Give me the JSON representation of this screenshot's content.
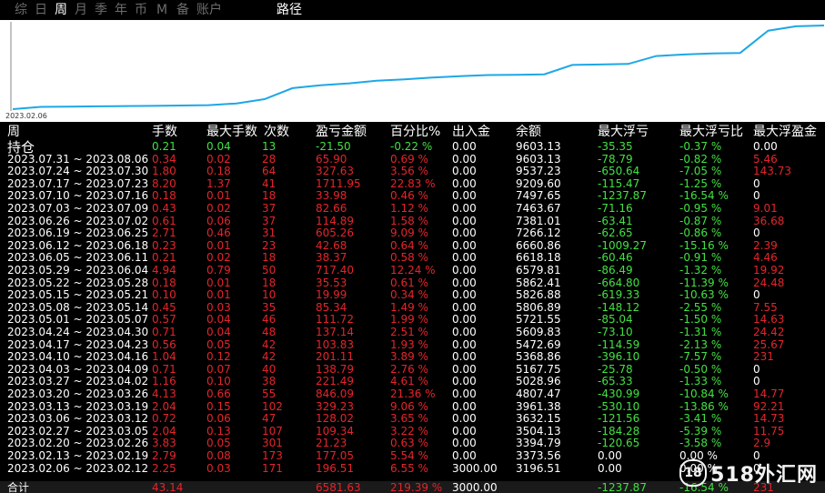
{
  "tabs": [
    {
      "label": "综",
      "active": false
    },
    {
      "label": "日",
      "active": false
    },
    {
      "label": "周",
      "active": true
    },
    {
      "label": "月",
      "active": false
    },
    {
      "label": "季",
      "active": false
    },
    {
      "label": "年",
      "active": false
    },
    {
      "label": "币",
      "active": false
    },
    {
      "label": "M",
      "active": false
    },
    {
      "label": "备",
      "active": false
    },
    {
      "label": "账户",
      "active": false
    }
  ],
  "path_label": "路径",
  "chart_data": {
    "type": "line",
    "x_start_label": "2023.02.06",
    "series": [
      {
        "values": [
          3196.51,
          3373.56,
          3394.79,
          3415.0,
          3432.0,
          3445.0,
          3474.0,
          3504.13,
          3632.15,
          3961.38,
          4807.47,
          5028.96,
          5167.75,
          5368.86,
          5472.69,
          5609.83,
          5721.55,
          5806.89,
          5826.88,
          5862.41,
          6579.81,
          6618.18,
          6660.86,
          7266.12,
          7381.01,
          7463.67,
          7497.65,
          9209.6,
          9537.23,
          9603.13
        ]
      }
    ],
    "color": "#1ea7e6"
  },
  "table": {
    "headers": [
      "周",
      "手数",
      "最大手数",
      "次数",
      "盈亏金额",
      "百分比%",
      "出入金",
      "余额",
      "最大浮亏",
      "最大浮亏比",
      "最大浮盈金"
    ],
    "rows": [
      {
        "label": "持仓",
        "cells": [
          "0.21",
          "0.04",
          "13",
          "-21.50",
          "-0.22 %",
          "0.00",
          "9603.13",
          "-35.35",
          "-0.37 %",
          "0.00"
        ],
        "tone": "green"
      },
      {
        "label": "2023.07.31 ~ 2023.08.06",
        "cells": [
          "0.34",
          "0.02",
          "28",
          "65.90",
          "0.69 %",
          "0.00",
          "9603.13",
          "-78.79",
          "-0.82 %",
          "5.46"
        ],
        "tone": "red"
      },
      {
        "label": "2023.07.24 ~ 2023.07.30",
        "cells": [
          "1.80",
          "0.18",
          "64",
          "327.63",
          "3.56 %",
          "0.00",
          "9537.23",
          "-650.64",
          "-7.05 %",
          "143.73"
        ],
        "tone": "red"
      },
      {
        "label": "2023.07.17 ~ 2023.07.23",
        "cells": [
          "8.20",
          "1.37",
          "41",
          "1711.95",
          "22.83 %",
          "0.00",
          "9209.60",
          "-115.47",
          "-1.25 %",
          "0"
        ],
        "tone": "red"
      },
      {
        "label": "2023.07.10 ~ 2023.07.16",
        "cells": [
          "0.18",
          "0.01",
          "18",
          "33.98",
          "0.46 %",
          "0.00",
          "7497.65",
          "-1237.87",
          "-16.54 %",
          "0"
        ],
        "tone": "red"
      },
      {
        "label": "2023.07.03 ~ 2023.07.09",
        "cells": [
          "0.43",
          "0.02",
          "37",
          "82.66",
          "1.12 %",
          "0.00",
          "7463.67",
          "-71.16",
          "-0.95 %",
          "9.01"
        ],
        "tone": "red"
      },
      {
        "label": "2023.06.26 ~ 2023.07.02",
        "cells": [
          "0.61",
          "0.06",
          "37",
          "114.89",
          "1.58 %",
          "0.00",
          "7381.01",
          "-63.41",
          "-0.87 %",
          "36.68"
        ],
        "tone": "red"
      },
      {
        "label": "2023.06.19 ~ 2023.06.25",
        "cells": [
          "2.71",
          "0.46",
          "31",
          "605.26",
          "9.09 %",
          "0.00",
          "7266.12",
          "-62.65",
          "-0.86 %",
          "0"
        ],
        "tone": "red"
      },
      {
        "label": "2023.06.12 ~ 2023.06.18",
        "cells": [
          "0.23",
          "0.01",
          "23",
          "42.68",
          "0.64 %",
          "0.00",
          "6660.86",
          "-1009.27",
          "-15.16 %",
          "2.39"
        ],
        "tone": "red"
      },
      {
        "label": "2023.06.05 ~ 2023.06.11",
        "cells": [
          "0.21",
          "0.02",
          "18",
          "38.37",
          "0.58 %",
          "0.00",
          "6618.18",
          "-60.46",
          "-0.91 %",
          "4.46"
        ],
        "tone": "red"
      },
      {
        "label": "2023.05.29 ~ 2023.06.04",
        "cells": [
          "4.94",
          "0.79",
          "50",
          "717.40",
          "12.24 %",
          "0.00",
          "6579.81",
          "-86.49",
          "-1.32 %",
          "19.92"
        ],
        "tone": "red"
      },
      {
        "label": "2023.05.22 ~ 2023.05.28",
        "cells": [
          "0.18",
          "0.01",
          "18",
          "35.53",
          "0.61 %",
          "0.00",
          "5862.41",
          "-664.80",
          "-11.39 %",
          "24.48"
        ],
        "tone": "red"
      },
      {
        "label": "2023.05.15 ~ 2023.05.21",
        "cells": [
          "0.10",
          "0.01",
          "10",
          "19.99",
          "0.34 %",
          "0.00",
          "5826.88",
          "-619.33",
          "-10.63 %",
          "0"
        ],
        "tone": "red"
      },
      {
        "label": "2023.05.08 ~ 2023.05.14",
        "cells": [
          "0.45",
          "0.03",
          "35",
          "85.34",
          "1.49 %",
          "0.00",
          "5806.89",
          "-148.12",
          "-2.55 %",
          "7.55"
        ],
        "tone": "red"
      },
      {
        "label": "2023.05.01 ~ 2023.05.07",
        "cells": [
          "0.57",
          "0.04",
          "46",
          "111.72",
          "1.99 %",
          "0.00",
          "5721.55",
          "-85.04",
          "-1.50 %",
          "14.63"
        ],
        "tone": "red"
      },
      {
        "label": "2023.04.24 ~ 2023.04.30",
        "cells": [
          "0.71",
          "0.04",
          "48",
          "137.14",
          "2.51 %",
          "0.00",
          "5609.83",
          "-73.10",
          "-1.31 %",
          "24.42"
        ],
        "tone": "red"
      },
      {
        "label": "2023.04.17 ~ 2023.04.23",
        "cells": [
          "0.56",
          "0.05",
          "42",
          "103.83",
          "1.93 %",
          "0.00",
          "5472.69",
          "-114.59",
          "-2.13 %",
          "25.67"
        ],
        "tone": "red"
      },
      {
        "label": "2023.04.10 ~ 2023.04.16",
        "cells": [
          "1.04",
          "0.12",
          "42",
          "201.11",
          "3.89 %",
          "0.00",
          "5368.86",
          "-396.10",
          "-7.57 %",
          "231"
        ],
        "tone": "red"
      },
      {
        "label": "2023.04.03 ~ 2023.04.09",
        "cells": [
          "0.71",
          "0.07",
          "40",
          "138.79",
          "2.76 %",
          "0.00",
          "5167.75",
          "-25.78",
          "-0.50 %",
          "0"
        ],
        "tone": "red"
      },
      {
        "label": "2023.03.27 ~ 2023.04.02",
        "cells": [
          "1.16",
          "0.10",
          "38",
          "221.49",
          "4.61 %",
          "0.00",
          "5028.96",
          "-65.33",
          "-1.33 %",
          "0"
        ],
        "tone": "red"
      },
      {
        "label": "2023.03.20 ~ 2023.03.26",
        "cells": [
          "4.13",
          "0.66",
          "55",
          "846.09",
          "21.36 %",
          "0.00",
          "4807.47",
          "-430.99",
          "-10.84 %",
          "14.77"
        ],
        "tone": "red"
      },
      {
        "label": "2023.03.13 ~ 2023.03.19",
        "cells": [
          "2.04",
          "0.15",
          "102",
          "329.23",
          "9.06 %",
          "0.00",
          "3961.38",
          "-530.10",
          "-13.86 %",
          "92.21"
        ],
        "tone": "red"
      },
      {
        "label": "2023.03.06 ~ 2023.03.12",
        "cells": [
          "0.72",
          "0.06",
          "47",
          "128.02",
          "3.65 %",
          "0.00",
          "3632.15",
          "-121.56",
          "-3.41 %",
          "14.73"
        ],
        "tone": "red"
      },
      {
        "label": "2023.02.27 ~ 2023.03.05",
        "cells": [
          "2.04",
          "0.13",
          "107",
          "109.34",
          "3.22 %",
          "0.00",
          "3504.13",
          "-184.28",
          "-5.39 %",
          "11.75"
        ],
        "tone": "red"
      },
      {
        "label": "2023.02.20 ~ 2023.02.26",
        "cells": [
          "3.83",
          "0.05",
          "301",
          "21.23",
          "0.63 %",
          "0.00",
          "3394.79",
          "-120.65",
          "-3.58 %",
          "2.9"
        ],
        "tone": "red"
      },
      {
        "label": "2023.02.13 ~ 2023.02.19",
        "cells": [
          "2.79",
          "0.08",
          "173",
          "177.05",
          "5.54 %",
          "0.00",
          "3373.56",
          "0.00",
          "0.00 %",
          "0"
        ],
        "tone": "red"
      },
      {
        "label": "2023.02.06 ~ 2023.02.12",
        "cells": [
          "2.25",
          "0.03",
          "171",
          "196.51",
          "6.55 %",
          "3000.00",
          "3196.51",
          "0.00",
          "0.00 %",
          "0"
        ],
        "tone": "red"
      }
    ],
    "total": {
      "label": "合计",
      "cells": [
        "43.14",
        "",
        "",
        "6581.63",
        "219.39 %",
        "3000.00",
        "",
        "-1237.87",
        "-16.54 %",
        "231"
      ]
    }
  },
  "watermark": {
    "logo": "18",
    "text": "518外汇网"
  }
}
